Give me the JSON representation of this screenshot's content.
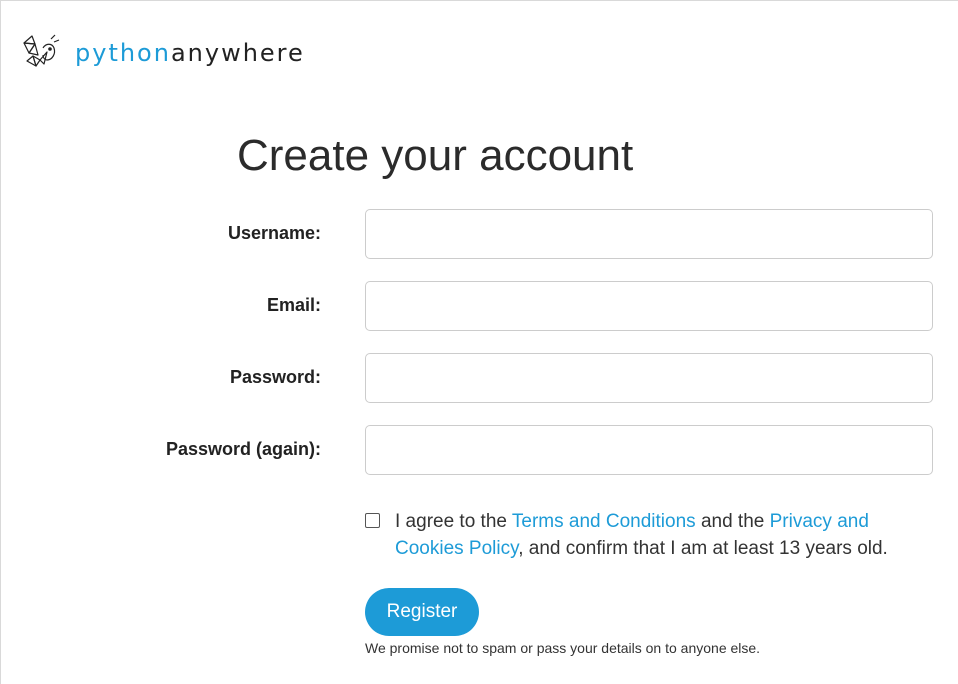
{
  "brand": {
    "python": "python",
    "anywhere": "anywhere"
  },
  "page": {
    "title": "Create your account"
  },
  "form": {
    "username": {
      "label": "Username:",
      "value": ""
    },
    "email": {
      "label": "Email:",
      "value": ""
    },
    "password": {
      "label": "Password:",
      "value": ""
    },
    "password_again": {
      "label": "Password (again):",
      "value": ""
    }
  },
  "agreement": {
    "prefix": "I agree to the ",
    "terms_link": "Terms and Conditions",
    "middle": " and the ",
    "privacy_link": "Privacy and Cookies Policy",
    "suffix": ", and confirm that I am at least 13 years old.",
    "checked": false
  },
  "register": {
    "button_label": "Register",
    "promise": "We promise not to spam or pass your details on to anyone else."
  },
  "colors": {
    "accent": "#1d9bd7",
    "text": "#222222",
    "border": "#cccccc"
  }
}
